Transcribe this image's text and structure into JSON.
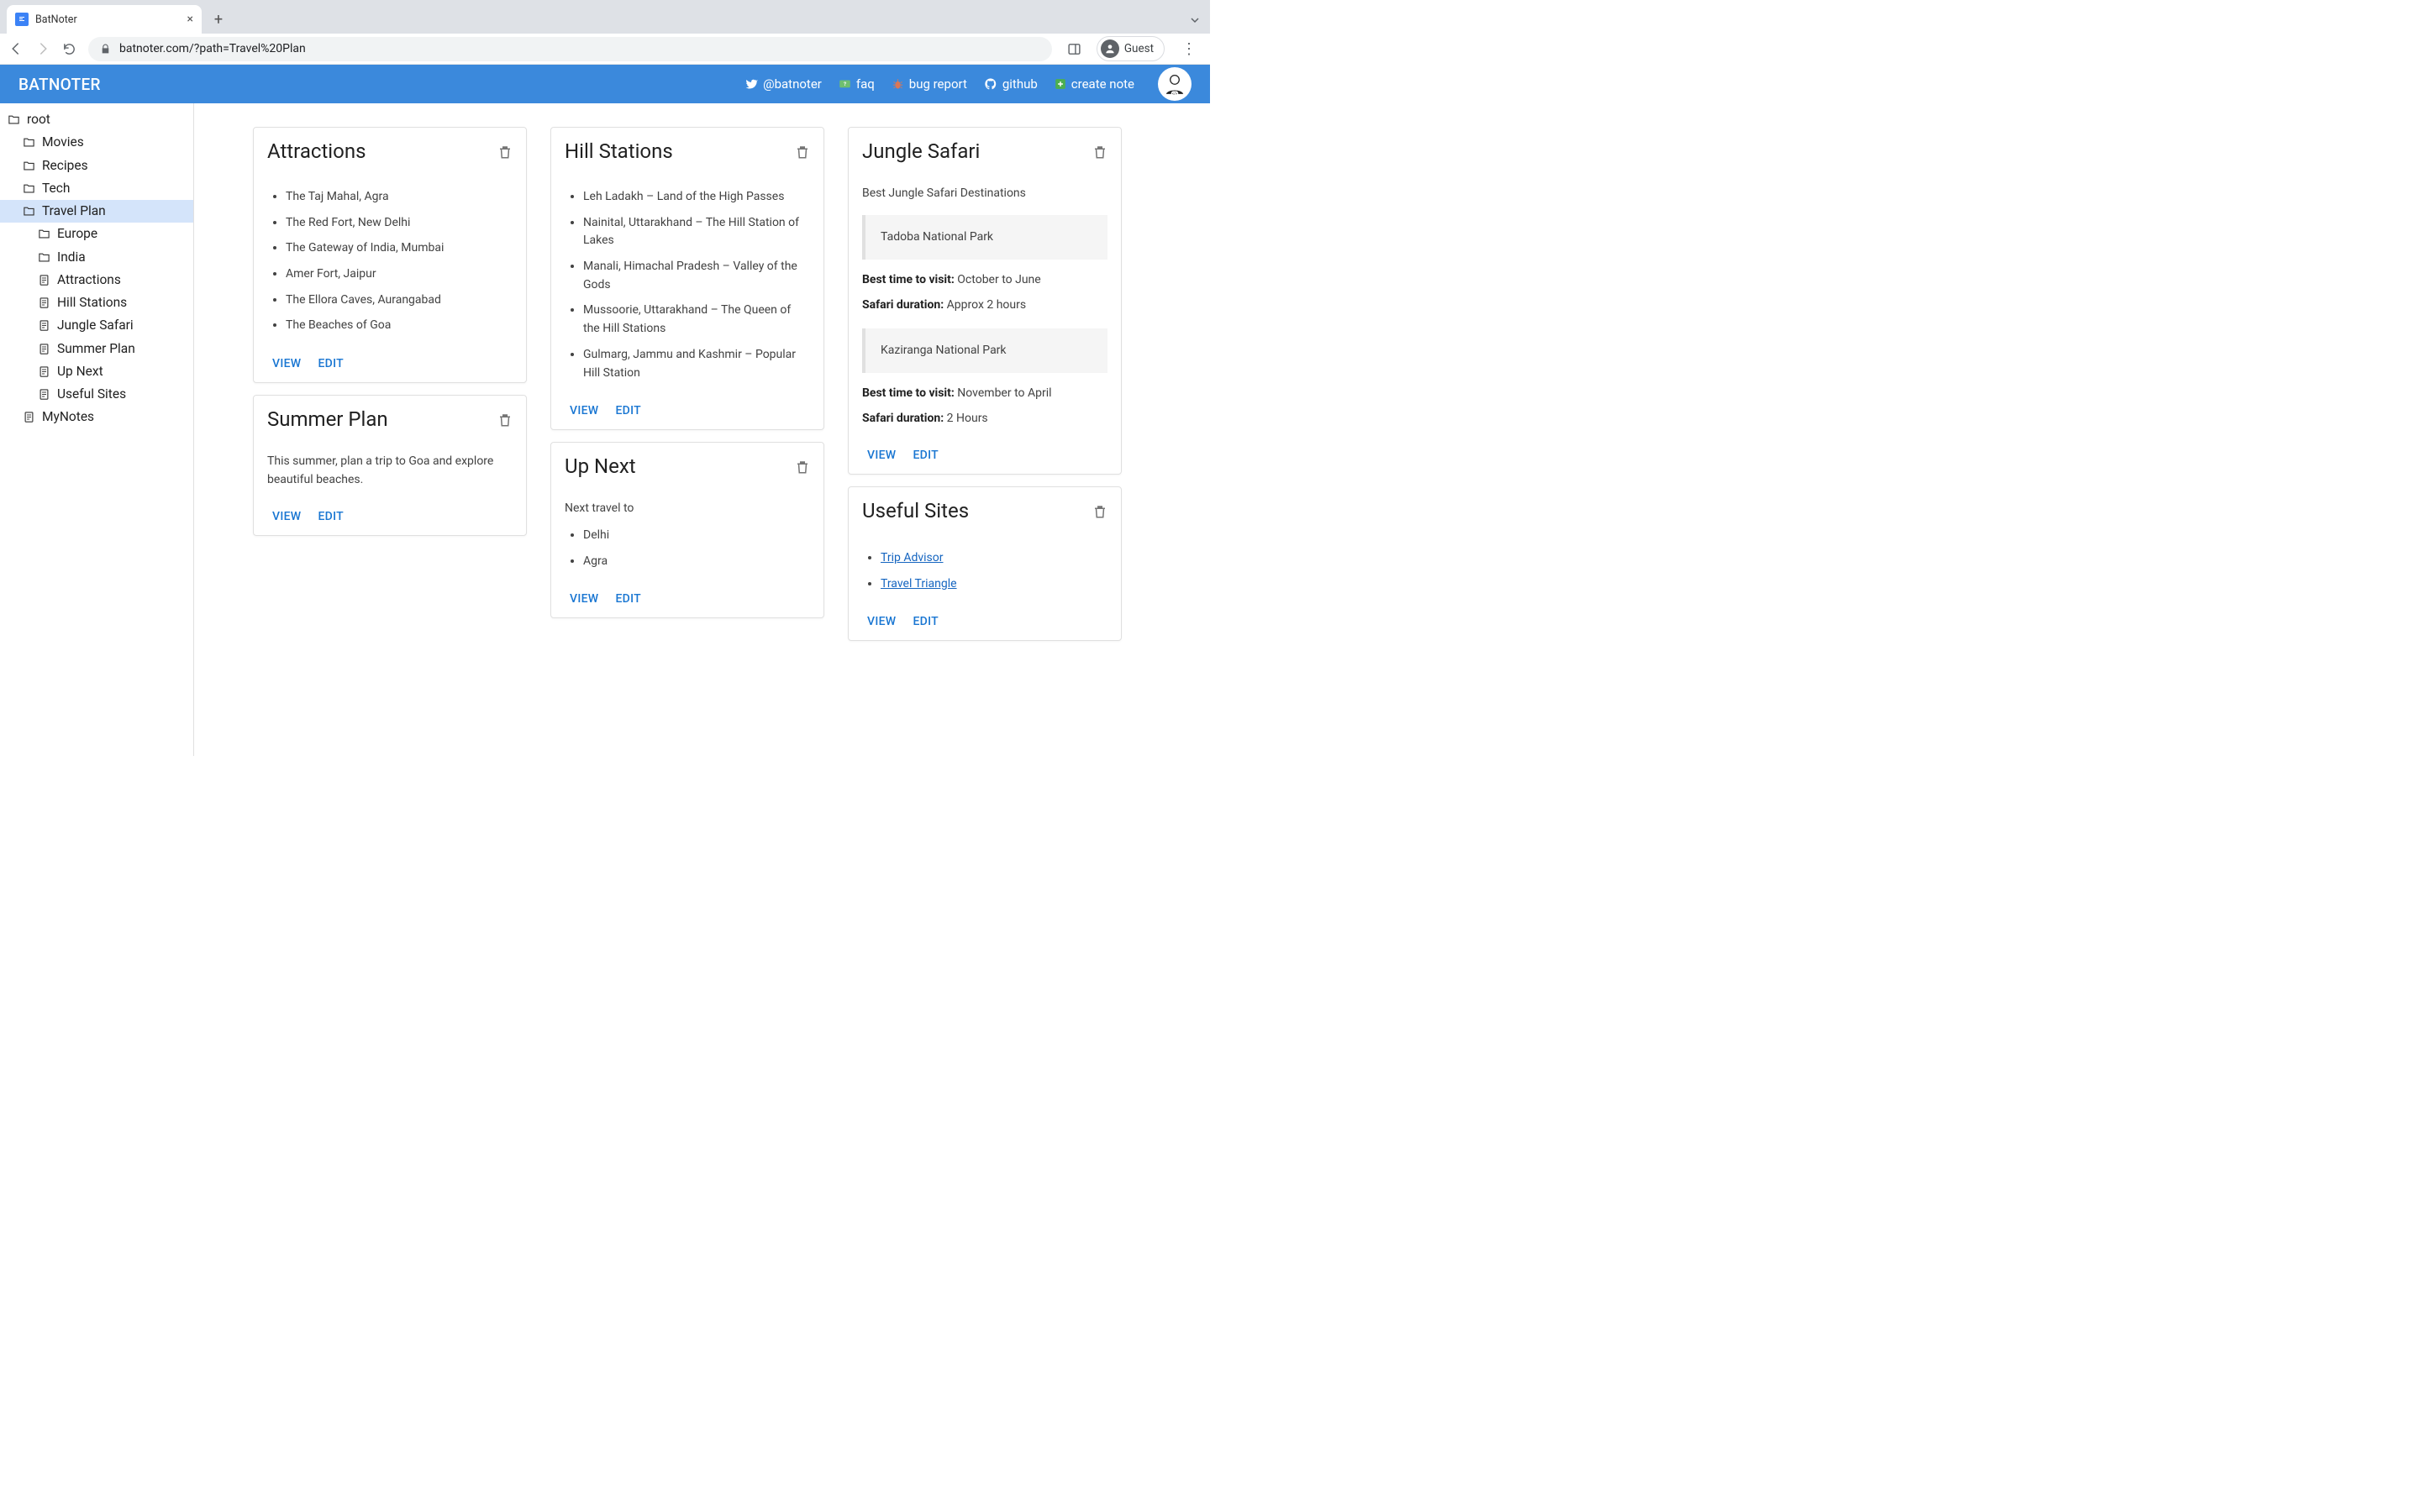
{
  "browser": {
    "tab_title": "BatNoter",
    "url": "batnoter.com/?path=Travel%20Plan",
    "guest_label": "Guest"
  },
  "header": {
    "brand": "BATNOTER",
    "links": {
      "twitter": "@batnoter",
      "faq": "faq",
      "bug": "bug report",
      "github": "github",
      "create": "create note"
    }
  },
  "sidebar": {
    "items": [
      {
        "label": "root",
        "depth": 0,
        "type": "folder"
      },
      {
        "label": "Movies",
        "depth": 1,
        "type": "folder"
      },
      {
        "label": "Recipes",
        "depth": 1,
        "type": "folder"
      },
      {
        "label": "Tech",
        "depth": 1,
        "type": "folder"
      },
      {
        "label": "Travel Plan",
        "depth": 1,
        "type": "folder",
        "active": true
      },
      {
        "label": "Europe",
        "depth": 2,
        "type": "folder"
      },
      {
        "label": "India",
        "depth": 2,
        "type": "folder"
      },
      {
        "label": "Attractions",
        "depth": 2,
        "type": "note"
      },
      {
        "label": "Hill Stations",
        "depth": 2,
        "type": "note"
      },
      {
        "label": "Jungle Safari",
        "depth": 2,
        "type": "note"
      },
      {
        "label": "Summer Plan",
        "depth": 2,
        "type": "note"
      },
      {
        "label": "Up Next",
        "depth": 2,
        "type": "note"
      },
      {
        "label": "Useful Sites",
        "depth": 2,
        "type": "note"
      },
      {
        "label": "MyNotes",
        "depth": 1,
        "type": "note"
      }
    ]
  },
  "actions": {
    "view": "VIEW",
    "edit": "EDIT"
  },
  "cards": {
    "attractions": {
      "title": "Attractions",
      "items": [
        "The Taj Mahal, Agra",
        "The Red Fort, New Delhi",
        "The Gateway of India, Mumbai",
        "Amer Fort, Jaipur",
        "The Ellora Caves, Aurangabad",
        "The Beaches of Goa"
      ]
    },
    "summer": {
      "title": "Summer Plan",
      "text": "This summer, plan a trip to Goa and explore beautiful beaches."
    },
    "hill": {
      "title": "Hill Stations",
      "items": [
        "Leh Ladakh – Land of the High Passes",
        "Nainital, Uttarakhand – The Hill Station of Lakes",
        "Manali, Himachal Pradesh – Valley of the Gods",
        "Mussoorie, Uttarakhand – The Queen of the Hill Stations",
        "Gulmarg, Jammu and Kashmir – Popular Hill Station"
      ]
    },
    "upnext": {
      "title": "Up Next",
      "intro": "Next travel to",
      "items": [
        "Delhi",
        "Agra"
      ]
    },
    "jungle": {
      "title": "Jungle Safari",
      "intro": "Best Jungle Safari Destinations",
      "park1": "Tadoba National Park",
      "bt1_label": "Best time to visit:",
      "bt1_val": " October to June",
      "sd1_label": "Safari duration:",
      "sd1_val": " Approx 2 hours",
      "park2": "Kaziranga National Park",
      "bt2_label": "Best time to visit:",
      "bt2_val": " November to April",
      "sd2_label": "Safari duration:",
      "sd2_val": " 2 Hours"
    },
    "useful": {
      "title": "Useful Sites",
      "links": [
        "Trip Advisor",
        "Travel Triangle"
      ]
    }
  }
}
